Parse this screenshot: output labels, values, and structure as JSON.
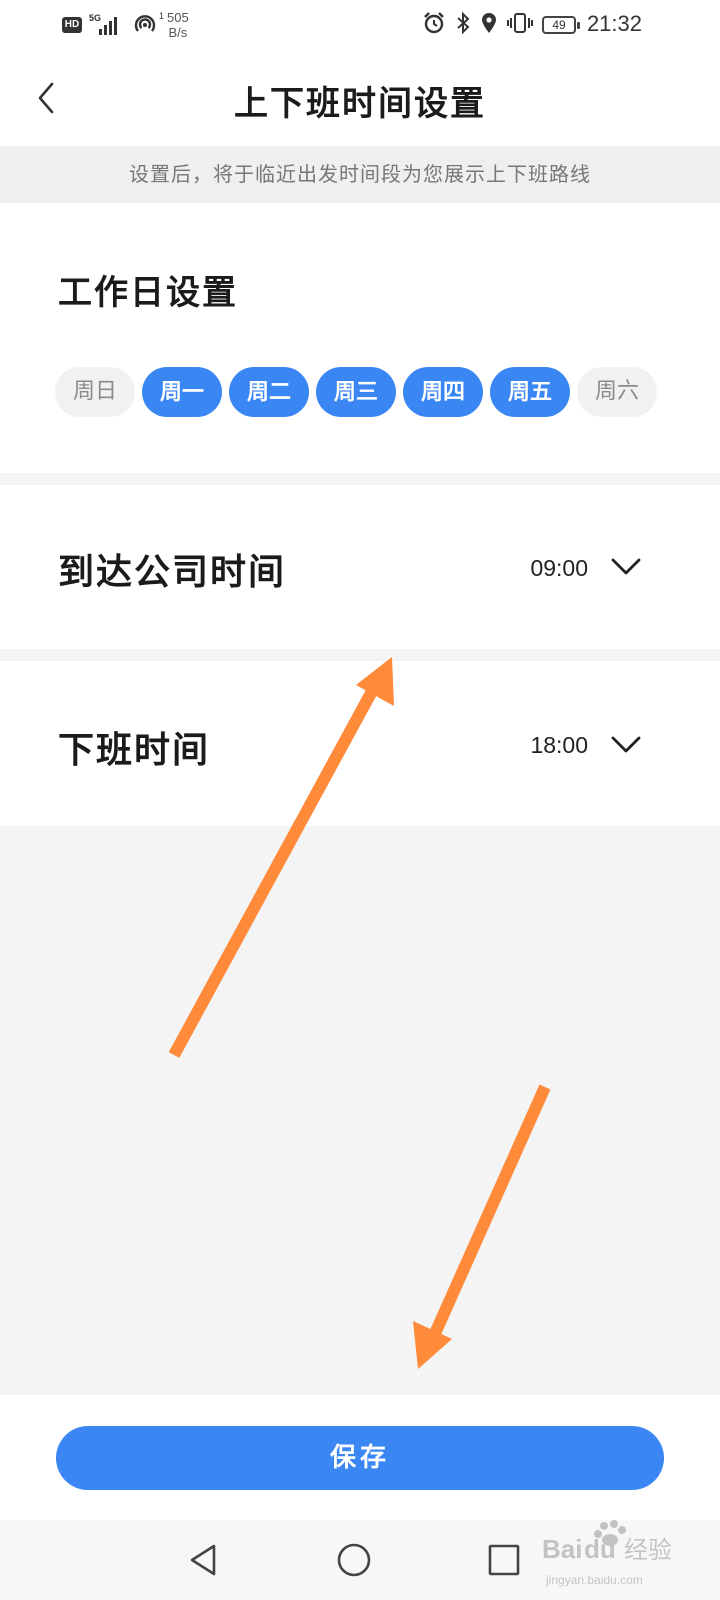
{
  "status_bar": {
    "hd_badge": "HD",
    "network_gen": "5G",
    "hotspot_count": "1",
    "speed_value": "505",
    "speed_unit": "B/s",
    "battery": "49",
    "time": "21:32",
    "icons": [
      "alarm-icon",
      "bluetooth-icon",
      "location-icon",
      "vibrate-icon"
    ]
  },
  "header": {
    "title": "上下班时间设置",
    "back_icon": "chevron-left-icon"
  },
  "hint": "设置后，将于临近出发时间段为您展示上下班路线",
  "workday": {
    "title": "工作日设置",
    "days": [
      {
        "label": "周日",
        "selected": false
      },
      {
        "label": "周一",
        "selected": true
      },
      {
        "label": "周二",
        "selected": true
      },
      {
        "label": "周三",
        "selected": true
      },
      {
        "label": "周四",
        "selected": true
      },
      {
        "label": "周五",
        "selected": true
      },
      {
        "label": "周六",
        "selected": false
      }
    ]
  },
  "arrive": {
    "label": "到达公司时间",
    "value": "09:00"
  },
  "leave": {
    "label": "下班时间",
    "value": "18:00"
  },
  "save": {
    "label": "保存"
  },
  "nav": {
    "icons": [
      "nav-back-icon",
      "nav-home-icon",
      "nav-recents-icon"
    ]
  },
  "colors": {
    "accent": "#3a86f3",
    "annotation_arrow": "#ff8a3a"
  },
  "watermark": {
    "brand": "Baidu",
    "product": "经验",
    "url": "jingyan.baidu.com"
  }
}
